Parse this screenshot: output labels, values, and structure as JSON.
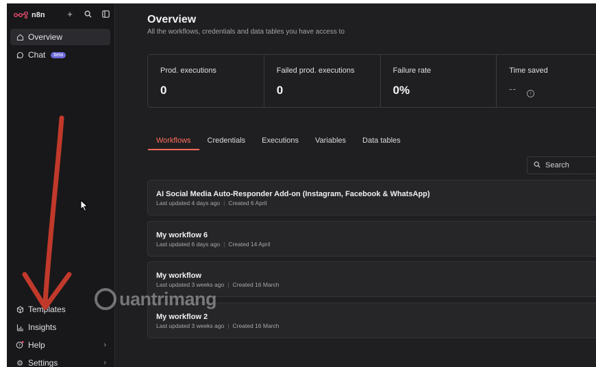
{
  "brand": {
    "name": "n8n"
  },
  "sidebar": {
    "top_items": [
      {
        "label": "Overview",
        "icon": "home-icon",
        "active": true
      },
      {
        "label": "Chat",
        "icon": "chat-icon",
        "badge": "beta"
      }
    ],
    "bottom_items": [
      {
        "label": "Templates",
        "icon": "templates-icon"
      },
      {
        "label": "Insights",
        "icon": "insights-icon"
      },
      {
        "label": "Help",
        "icon": "help-icon"
      },
      {
        "label": "Settings",
        "icon": "settings-icon"
      }
    ]
  },
  "page": {
    "title": "Overview",
    "subtitle": "All the workflows, credentials and data tables you have access to"
  },
  "stats": [
    {
      "label": "Prod. executions",
      "value": "0"
    },
    {
      "label": "Failed prod. executions",
      "value": "0"
    },
    {
      "label": "Failure rate",
      "value": "0%"
    },
    {
      "label": "Time saved",
      "value": "--"
    }
  ],
  "tabs": [
    "Workflows",
    "Credentials",
    "Executions",
    "Variables",
    "Data tables"
  ],
  "search": {
    "placeholder": "Search"
  },
  "workflows": [
    {
      "title": "AI Social Media Auto-Responder Add-on (Instagram, Facebook & WhatsApp)",
      "updated": "Last updated 4 days ago",
      "created": "Created 6 April"
    },
    {
      "title": "My workflow 6",
      "updated": "Last updated 6 days ago",
      "created": "Created 14 April"
    },
    {
      "title": "My workflow",
      "updated": "Last updated 3 weeks ago",
      "created": "Created 16 March"
    },
    {
      "title": "My workflow 2",
      "updated": "Last updated 3 weeks ago",
      "created": "Created 16 March"
    }
  ],
  "watermark": {
    "text": "uantrimang"
  },
  "colors": {
    "accent": "#ff6d5a",
    "annotation_arrow": "#c0392b",
    "background": "#1f1f22",
    "sidebar": "#18181a"
  }
}
